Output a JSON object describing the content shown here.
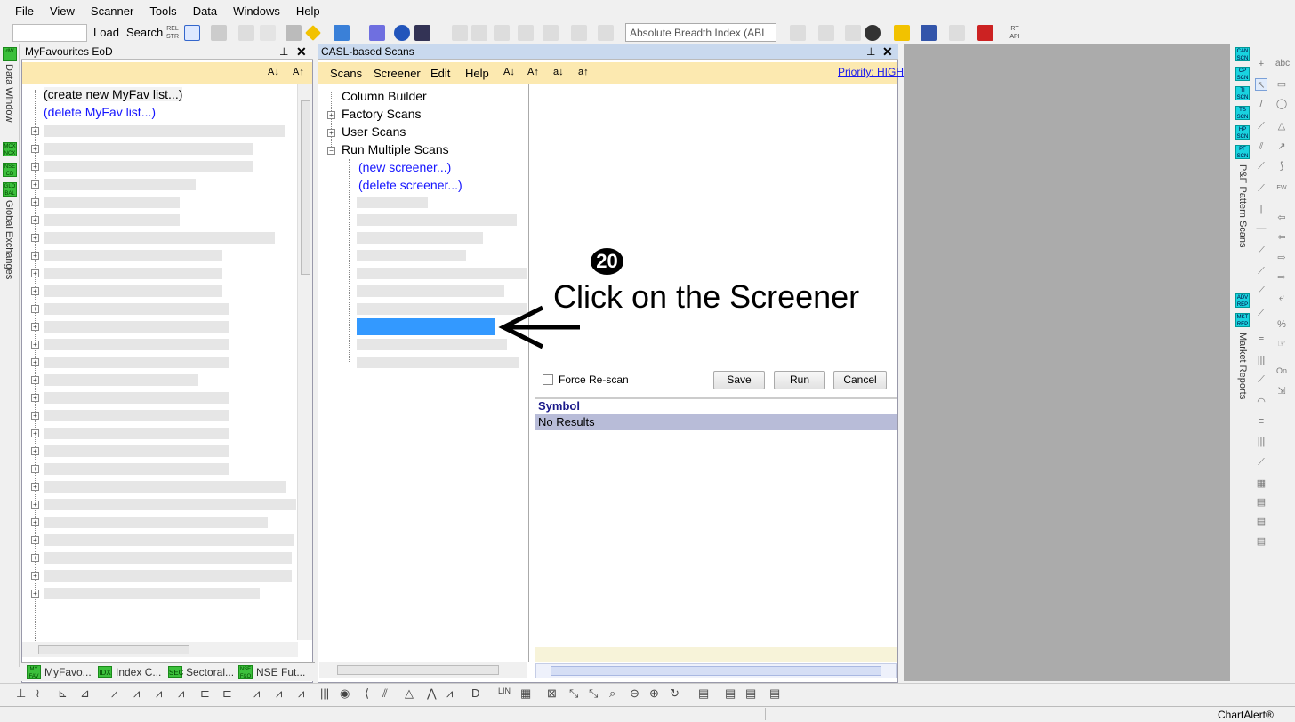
{
  "menubar": {
    "items": [
      "File",
      "View",
      "Scanner",
      "Tools",
      "Data",
      "Windows",
      "Help"
    ]
  },
  "toolbar": {
    "load": "Load",
    "search": "Search",
    "indicator_select": "Absolute Breadth Index (ABI"
  },
  "left_strip": {
    "data_window": "Data Window",
    "global_exchanges": "Global Exchanges"
  },
  "favourites": {
    "title": "MyFavourites EoD",
    "create": "(create new MyFav list...)",
    "delete": "(delete MyFav list...)"
  },
  "scans": {
    "title": "CASL-based Scans",
    "menu": [
      "Scans",
      "Screener",
      "Edit",
      "Help"
    ],
    "priority": "Priority: HIGH",
    "tree": {
      "column_builder": "Column Builder",
      "factory_scans": "Factory Scans",
      "user_scans": "User Scans",
      "run_multiple": "Run Multiple Scans",
      "new_screener": "(new screener...)",
      "delete_screener": "(delete screener...)"
    },
    "force_rescan": "Force Re-scan",
    "save": "Save",
    "run": "Run",
    "cancel": "Cancel",
    "results_header": "Symbol",
    "results_empty": "No Results"
  },
  "annotation": {
    "step": "20",
    "text": "Click on the Screener"
  },
  "bottom_tabs": [
    "MyFavo...",
    "Index C...",
    "Sectoral...",
    "NSE Fut..."
  ],
  "right_strip": {
    "pf_scans": "P&F Pattern Scans",
    "market_reports": "Market Reports"
  },
  "status": {
    "brand": "ChartAlert®"
  },
  "colors": {
    "accent": "#3399ff",
    "panel_header": "#fce9b0",
    "results_header": "#b8bcd8"
  }
}
